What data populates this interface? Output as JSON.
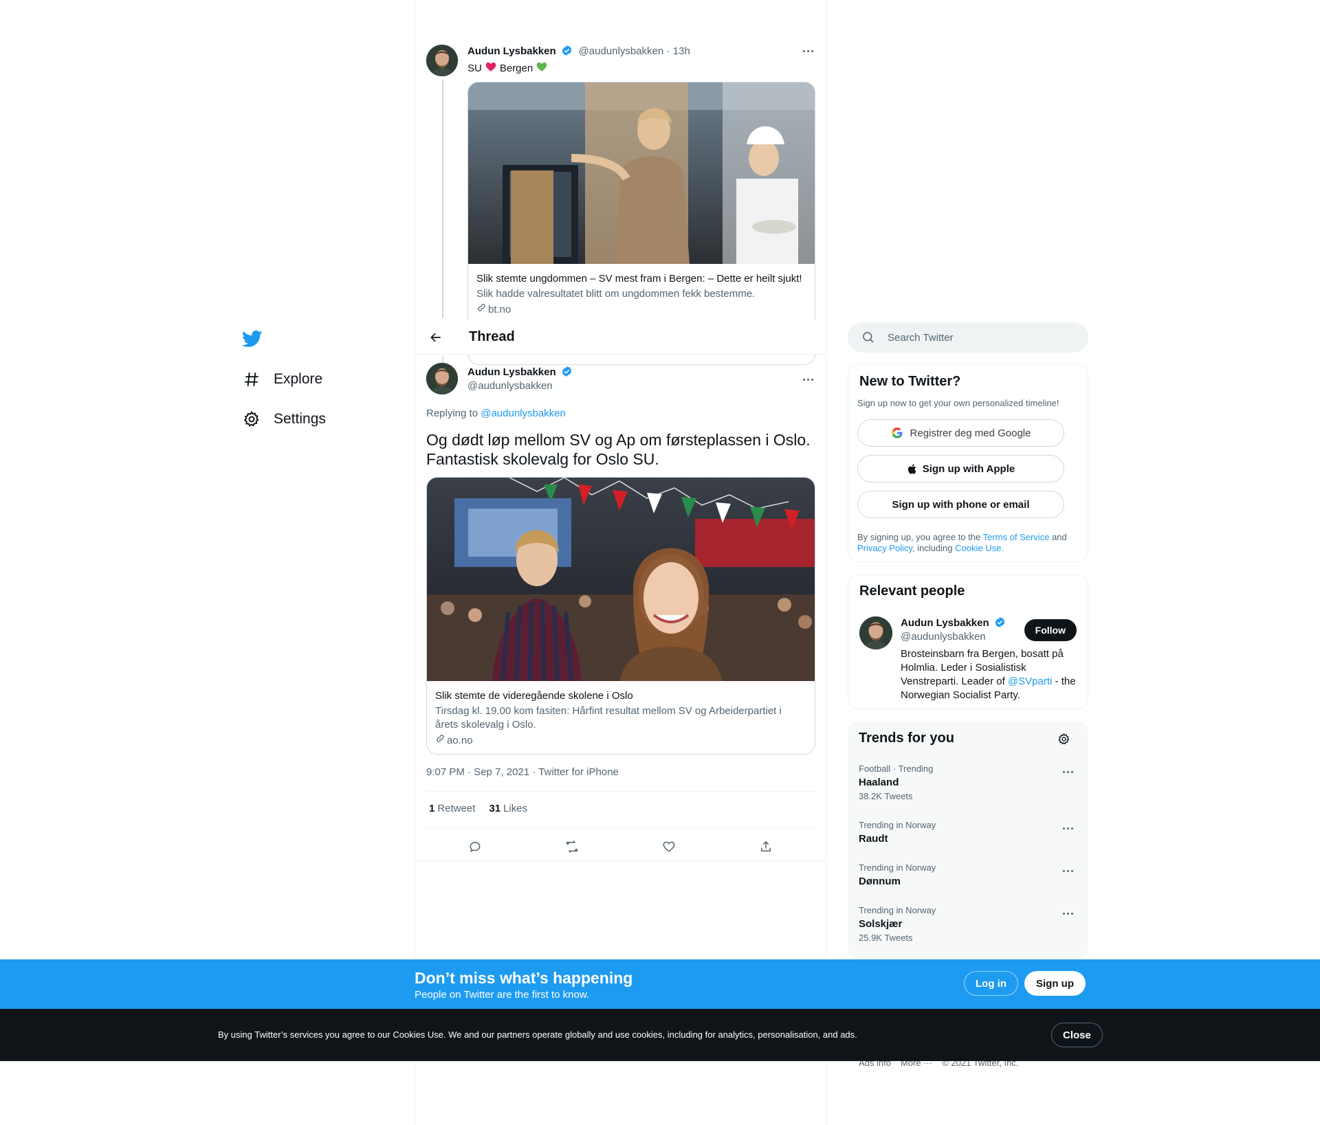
{
  "nav": {
    "items": [
      {
        "label": "Explore",
        "icon": "hashtag-icon"
      },
      {
        "label": "Settings",
        "icon": "gear-icon"
      }
    ]
  },
  "parent_tweet": {
    "name": "Audun Lysbakken",
    "handle": "@audunlysbakken",
    "time": "· 13h",
    "text_parts": [
      "SU",
      "❤️",
      "Bergen",
      "💚"
    ],
    "card": {
      "title": "Slik stemte ungdommen – SV mest fram i Bergen: – Dette er heilt sjukt!",
      "description": "Slik hadde valresultatet blitt om ungdommen fekk bestemme.",
      "domain": "bt.no"
    }
  },
  "thread_header": {
    "title": "Thread"
  },
  "main_tweet": {
    "name": "Audun Lysbakken",
    "handle": "@audunlysbakken",
    "replying_prefix": "Replying to",
    "replying_to": "@audunlysbakken",
    "text": "Og dødt løp mellom SV og Ap om førsteplassen i Oslo. Fantastisk skolevalg for Oslo SU.",
    "card": {
      "title": "Slik stemte de videregående skolene i Oslo",
      "description": "Tirsdag kl. 19.00 kom fasiten: Hårfint resultat mellom SV og Arbeiderpartiet i årets skolevalg i Oslo.",
      "domain": "ao.no"
    },
    "timestamp": "9:07 PM · Sep 7, 2021 · Twitter for iPhone",
    "retweets_count": "1",
    "retweets_label": "Retweet",
    "likes_count": "31",
    "likes_label": "Likes"
  },
  "search": {
    "placeholder": "Search Twitter"
  },
  "signup_panel": {
    "title": "New to Twitter?",
    "subtitle": "Sign up now to get your own personalized timeline!",
    "google": "Registrer deg med Google",
    "apple": "Sign up with Apple",
    "phone": "Sign up with phone or email",
    "legal_1": "By signing up, you agree to the",
    "terms": "Terms of Service",
    "legal_and": "and",
    "privacy": "Privacy Policy",
    "legal_including": ", including",
    "cookie": "Cookie Use."
  },
  "relevant": {
    "title": "Relevant people",
    "name": "Audun Lysbakken",
    "handle": "@audunlysbakken",
    "follow": "Follow",
    "bio_1": "Brosteinsbarn fra Bergen, bosatt på Holmlia. Leder i Sosialistisk Venstreparti. Leader of",
    "bio_link": "@SVparti",
    "bio_2": "- the Norwegian Socialist Party."
  },
  "trends": {
    "title": "Trends for you",
    "items": [
      {
        "context": "Football · Trending",
        "name": "Haaland",
        "count": "38.2K Tweets"
      },
      {
        "context": "Trending in Norway",
        "name": "Raudt",
        "count": ""
      },
      {
        "context": "Trending in Norway",
        "name": "Dønnum",
        "count": ""
      },
      {
        "context": "Trending in Norway",
        "name": "Solskjær",
        "count": "25.9K Tweets"
      }
    ]
  },
  "footer": {
    "ads": "Ads info",
    "more": "More ···",
    "copyright": "© 2021 Twitter, Inc."
  },
  "banner": {
    "headline": "Don’t miss what’s happening",
    "sub": "People on Twitter are the first to know.",
    "login": "Log in",
    "signup": "Sign up"
  },
  "cookie_bar": {
    "text": "By using Twitter’s services you agree to our Cookies Use. We and our partners operate globally and use cookies, including for analytics, personalisation, and ads.",
    "close": "Close"
  },
  "colors": {
    "accent": "#1d9bf0",
    "text": "#0f1419",
    "muted": "#536471",
    "dark_bar": "#0f1419"
  }
}
